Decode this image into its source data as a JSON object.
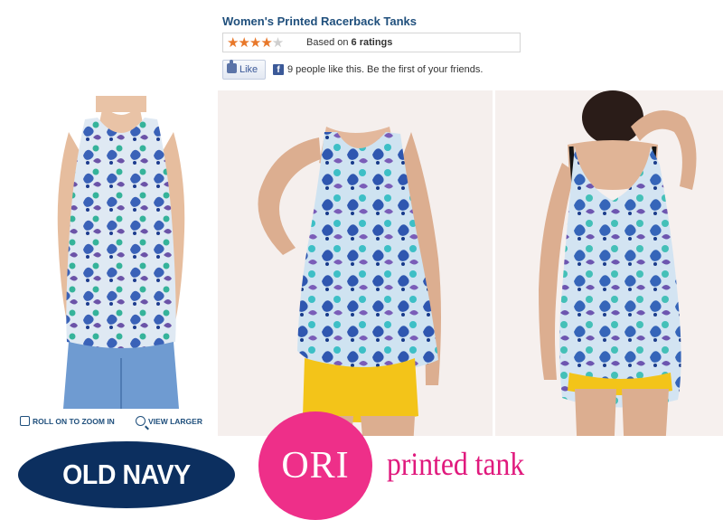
{
  "product": {
    "title": "Women's Printed Racerback Tanks",
    "stars": "★★★★",
    "half_star": "★",
    "rating_prefix": "Based on",
    "rating_count": "6 ratings"
  },
  "social": {
    "like_label": "Like",
    "fb_icon": "f",
    "like_text": "9 people like this. Be the first of your friends."
  },
  "image_links": {
    "zoom_label": "ROLL ON TO ZOOM IN",
    "view_larger_label": "VIEW LARGER"
  },
  "brands": {
    "store_logo": "OLD NAVY",
    "ori_logo": "ORI",
    "tagline": "printed tank"
  },
  "colors": {
    "title": "#1f4f7c",
    "stars": "#e8782a",
    "oldnavy_bg": "#0c2f5f",
    "ori_pink": "#ee2f89",
    "tagline_pink": "#e0197d",
    "skirt_yellow": "#f3c419",
    "paisley_blue": "#3a62b8"
  }
}
